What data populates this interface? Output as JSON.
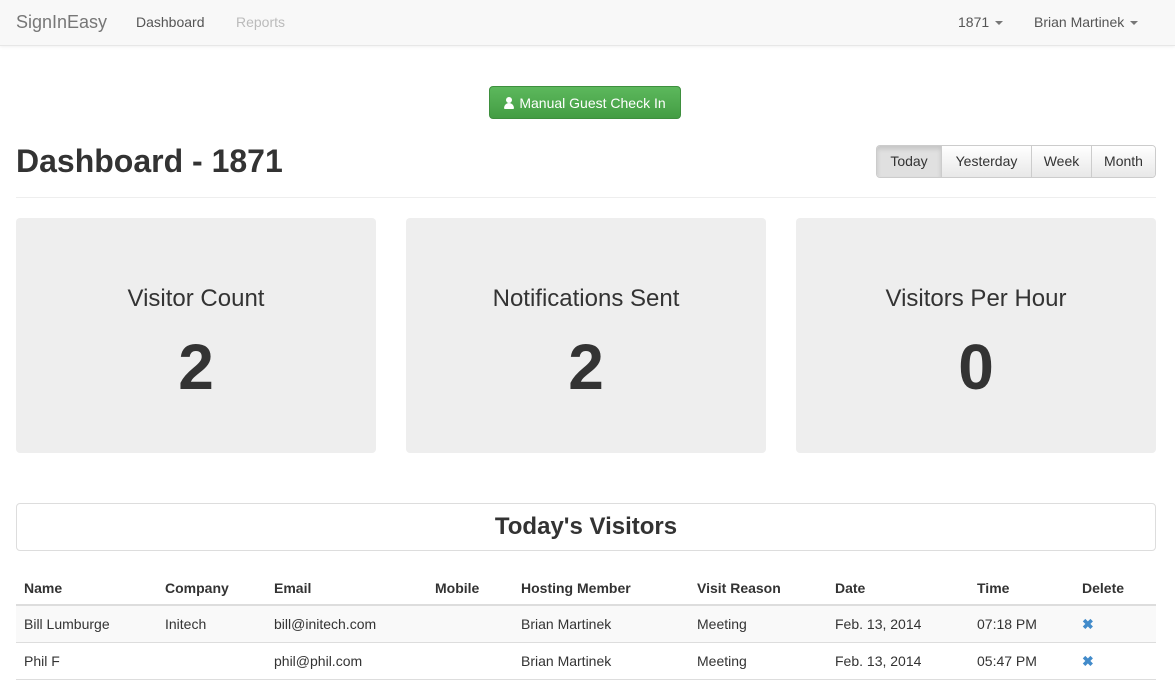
{
  "navbar": {
    "brand": "SignInEasy",
    "links": [
      "Dashboard",
      "Reports"
    ],
    "location_dropdown": "1871",
    "user_dropdown": "Brian Martinek"
  },
  "checkin_button": "Manual Guest Check In",
  "page_title": "Dashboard - 1871",
  "range_buttons": {
    "items": [
      "Today",
      "Yesterday",
      "Week",
      "Month"
    ],
    "selected": "Today"
  },
  "stats": [
    {
      "label": "Visitor Count",
      "value": "2"
    },
    {
      "label": "Notifications Sent",
      "value": "2"
    },
    {
      "label": "Visitors Per Hour",
      "value": "0"
    }
  ],
  "visitors": {
    "title": "Today's Visitors",
    "columns": [
      "Name",
      "Company",
      "Email",
      "Mobile",
      "Hosting Member",
      "Visit Reason",
      "Date",
      "Time",
      "Delete"
    ],
    "rows": [
      {
        "name": "Bill Lumburge",
        "company": "Initech",
        "email": "bill@initech.com",
        "mobile": "",
        "host": "Brian Martinek",
        "reason": "Meeting",
        "date": "Feb. 13, 2014",
        "time": "07:18 PM",
        "delete_icon": "✖"
      },
      {
        "name": "Phil F",
        "company": "",
        "email": "phil@phil.com",
        "mobile": "",
        "host": "Brian Martinek",
        "reason": "Meeting",
        "date": "Feb. 13, 2014",
        "time": "05:47 PM",
        "delete_icon": "✖"
      }
    ]
  },
  "colors": {
    "primary_green": "#5cb85c",
    "link_blue": "#428bca"
  }
}
